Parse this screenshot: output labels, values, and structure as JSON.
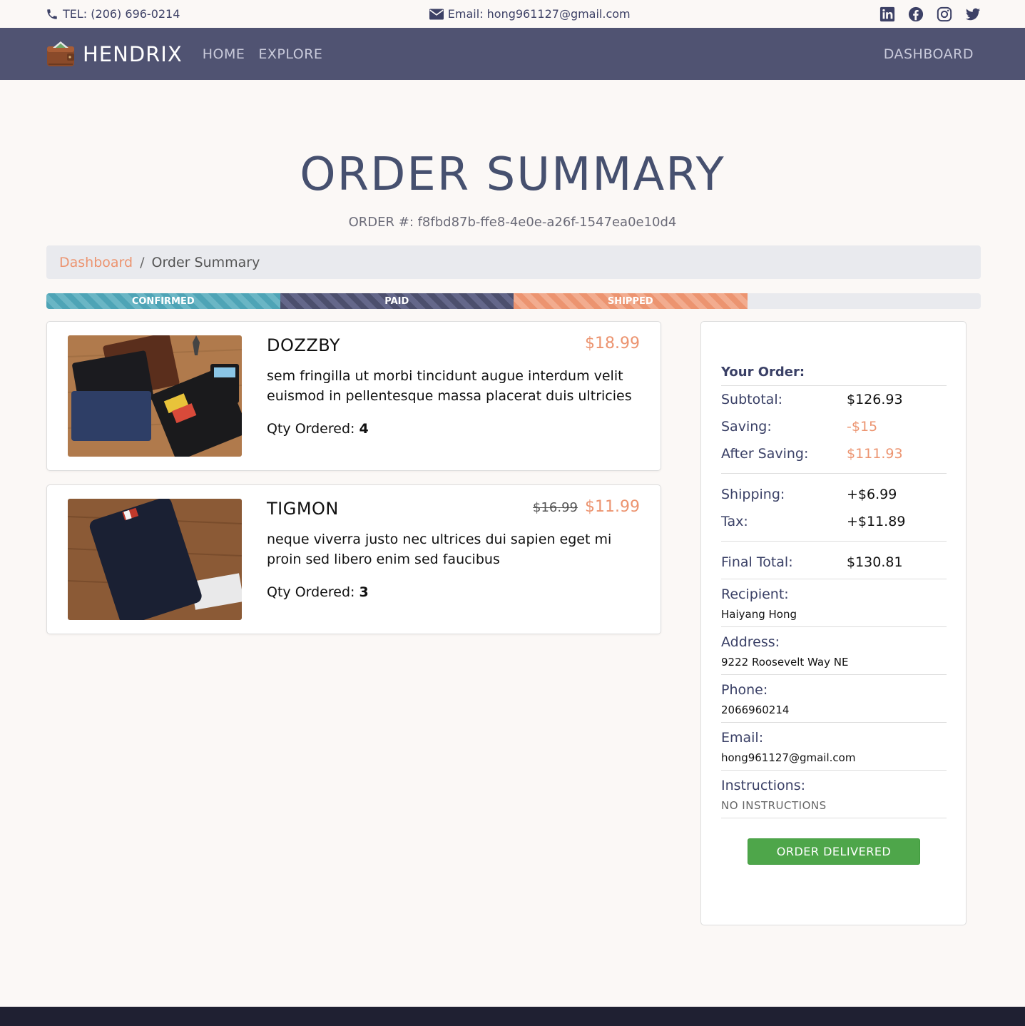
{
  "topbar": {
    "tel": "TEL: (206) 696-0214",
    "email": "Email: hong961127@gmail.com",
    "social_icons": [
      "linkedin-icon",
      "facebook-icon",
      "instagram-icon",
      "twitter-icon"
    ]
  },
  "nav": {
    "brand": "HENDRIX",
    "home": "HOME",
    "explore": "EXPLORE",
    "dashboard": "DASHBOARD"
  },
  "page": {
    "title": "ORDER SUMMARY",
    "order_number": "ORDER #: f8fbd87b-ffe8-4e0e-a26f-1547ea0e10d4"
  },
  "breadcrumb": {
    "link": "Dashboard",
    "separator": "/",
    "current": "Order Summary"
  },
  "progress": {
    "steps": [
      "CONFIRMED",
      "PAID",
      "SHIPPED"
    ],
    "completed_fraction": 0.75
  },
  "items": [
    {
      "name": "DOZZBY",
      "price": "$18.99",
      "old_price": "",
      "description": "sem fringilla ut morbi tincidunt augue interdum velit euismod in pellentesque massa placerat duis ultricies",
      "qty_label": "Qty Ordered:",
      "qty": "4"
    },
    {
      "name": "TIGMON",
      "price": "$11.99",
      "old_price": "$16.99",
      "description": "neque viverra justo nec ultrices dui sapien eget mi proin sed libero enim sed faucibus",
      "qty_label": "Qty Ordered:",
      "qty": "3"
    }
  ],
  "summary": {
    "heading": "Your Order:",
    "subtotal_label": "Subtotal:",
    "subtotal": "$126.93",
    "saving_label": "Saving:",
    "saving": "-$15",
    "after_saving_label": "After Saving:",
    "after_saving": "$111.93",
    "shipping_label": "Shipping:",
    "shipping": "+$6.99",
    "tax_label": "Tax:",
    "tax": "+$11.89",
    "final_label": "Final Total:",
    "final": "$130.81",
    "recipient_label": "Recipient:",
    "recipient": "Haiyang Hong",
    "address_label": "Address:",
    "address": "9222 Roosevelt Way NE",
    "phone_label": "Phone:",
    "phone": "2066960214",
    "email_label": "Email:",
    "email": "hong961127@gmail.com",
    "instructions_label": "Instructions:",
    "instructions": "NO INSTRUCTIONS",
    "status_button": "ORDER DELIVERED"
  },
  "colors": {
    "nav_bg": "#505372",
    "accent": "#ec9470",
    "title": "#46506f",
    "confirmed": "#4ea4b6",
    "paid": "#4c4f6d",
    "shipped": "#ec9470",
    "delivered": "#4ea64a",
    "footer": "#1f2032"
  }
}
